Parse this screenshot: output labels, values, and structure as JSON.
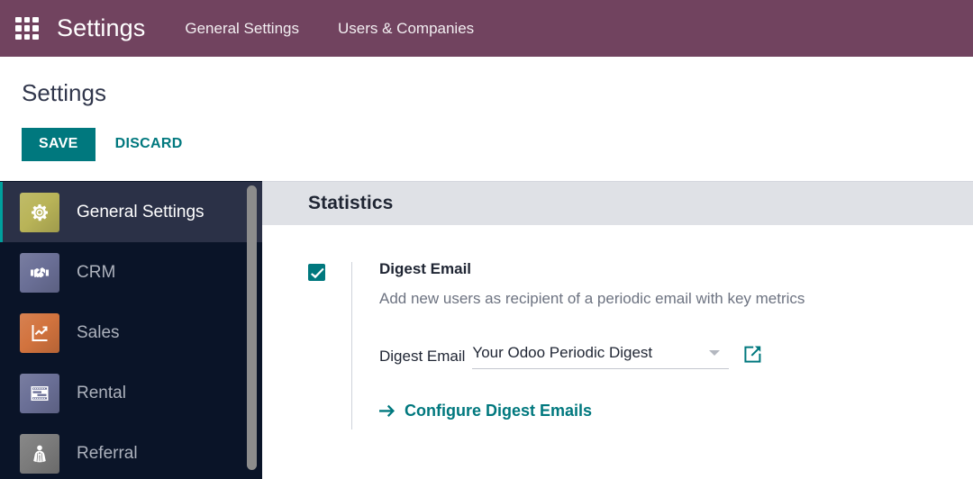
{
  "topbar": {
    "apps_icon": "apps-grid-icon",
    "brand": "Settings",
    "menus": [
      {
        "label": "General Settings"
      },
      {
        "label": "Users & Companies"
      }
    ],
    "background_color": "#71435F"
  },
  "control_panel": {
    "title": "Settings",
    "save_label": "SAVE",
    "discard_label": "DISCARD",
    "save_color": "#00787E",
    "discard_color": "#00787E"
  },
  "sidebar": {
    "items": [
      {
        "label": "General Settings",
        "icon": "gear-icon",
        "icon_color": "#b9b458",
        "active": true
      },
      {
        "label": "CRM",
        "icon": "handshake-icon",
        "icon_color": "#6a6f96",
        "active": false
      },
      {
        "label": "Sales",
        "icon": "sales-chart-icon",
        "icon_color": "#d2733e",
        "active": false
      },
      {
        "label": "Rental",
        "icon": "rental-gantt-icon",
        "icon_color": "#6a6f96",
        "active": false
      },
      {
        "label": "Referral",
        "icon": "referral-cape-icon",
        "icon_color": "#7b7b7b",
        "active": false
      }
    ],
    "active_accent_color": "#00A09D",
    "background_color": "#0A1428",
    "active_background_color": "#2B3147",
    "scrollbar": "sidebar-scrollbar"
  },
  "content": {
    "section_title": "Statistics",
    "setting": {
      "checkbox_checked": true,
      "label": "Digest Email",
      "help": "Add new users as recipient of a periodic email with key metrics",
      "field_label": "Digest Email",
      "field_value": "Your Odoo Periodic Digest",
      "external_link_icon": "external-link-icon",
      "caret_icon": "chevron-down-icon",
      "configure_link": "Configure Digest Emails",
      "configure_arrow_icon": "arrow-right-icon",
      "link_color": "#00787E"
    }
  }
}
